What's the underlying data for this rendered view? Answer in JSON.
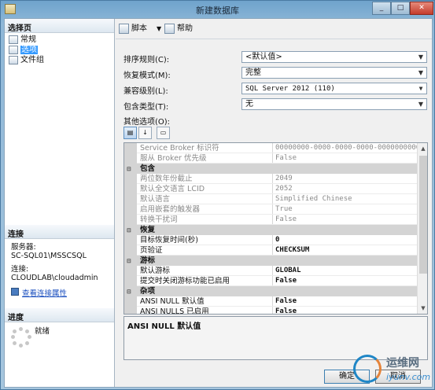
{
  "window": {
    "title": "新建数据库",
    "minimize": "_",
    "maximize": "□",
    "close": "✕"
  },
  "left": {
    "select_page_header": "选择页",
    "pages": [
      {
        "label": "常规"
      },
      {
        "label": "选项"
      },
      {
        "label": "文件组"
      }
    ],
    "connection_header": "连接",
    "server_label": "服务器:",
    "server_value": "SC-SQL01\\MSSCSQL",
    "connection_label": "连接:",
    "connection_value": "CLOUDLAB\\cloudadmin",
    "view_properties_link": "查看连接属性",
    "progress_header": "进度",
    "progress_status": "就绪"
  },
  "toolbar": {
    "script_label": "脚本",
    "script_dropdown": "▼",
    "help_label": "帮助"
  },
  "form": {
    "collation_label": "排序规则(C):",
    "collation_value": "<默认值>",
    "recovery_label": "恢复模式(M):",
    "recovery_value": "完整",
    "compat_label": "兼容级别(L):",
    "compat_value": "SQL Server 2012 (110)",
    "containment_label": "包含类型(T):",
    "containment_value": "无",
    "other_options_label": "其他选项(O):"
  },
  "grid": {
    "rows": [
      {
        "name": "Service Broker 标识符",
        "value": "00000000-0000-0000-0000-000000000000",
        "kind": "dis"
      },
      {
        "name": "服从 Broker 优先级",
        "value": "False",
        "kind": "dis"
      },
      {
        "name": "包含",
        "value": "",
        "kind": "cat"
      },
      {
        "name": "两位数年份截止",
        "value": "2049",
        "kind": "dis"
      },
      {
        "name": "默认全文语言 LCID",
        "value": "2052",
        "kind": "dis"
      },
      {
        "name": "默认语言",
        "value": "Simplified Chinese",
        "kind": "dis"
      },
      {
        "name": "启用嵌套的触发器",
        "value": "True",
        "kind": "dis"
      },
      {
        "name": "转换干扰词",
        "value": "False",
        "kind": "dis"
      },
      {
        "name": "恢复",
        "value": "",
        "kind": "cat"
      },
      {
        "name": "目标恢复时间(秒)",
        "value": "0",
        "kind": "bold"
      },
      {
        "name": "页验证",
        "value": "CHECKSUM",
        "kind": "bold"
      },
      {
        "name": "游标",
        "value": "",
        "kind": "cat"
      },
      {
        "name": "默认游标",
        "value": "GLOBAL",
        "kind": "bold"
      },
      {
        "name": "提交时关闭游标功能已启用",
        "value": "False",
        "kind": "bold"
      },
      {
        "name": "杂项",
        "value": "",
        "kind": "cat"
      },
      {
        "name": "ANSI NULL 默认值",
        "value": "False",
        "kind": "bold"
      },
      {
        "name": "ANSI NULLS 已启用",
        "value": "False",
        "kind": "bold"
      }
    ],
    "collapse_glyph": "⊟"
  },
  "description": "ANSI NULL 默认值",
  "buttons": {
    "ok": "确定",
    "cancel": "取消"
  },
  "watermark": {
    "cn": "运维网",
    "en": "iyunv.com"
  }
}
